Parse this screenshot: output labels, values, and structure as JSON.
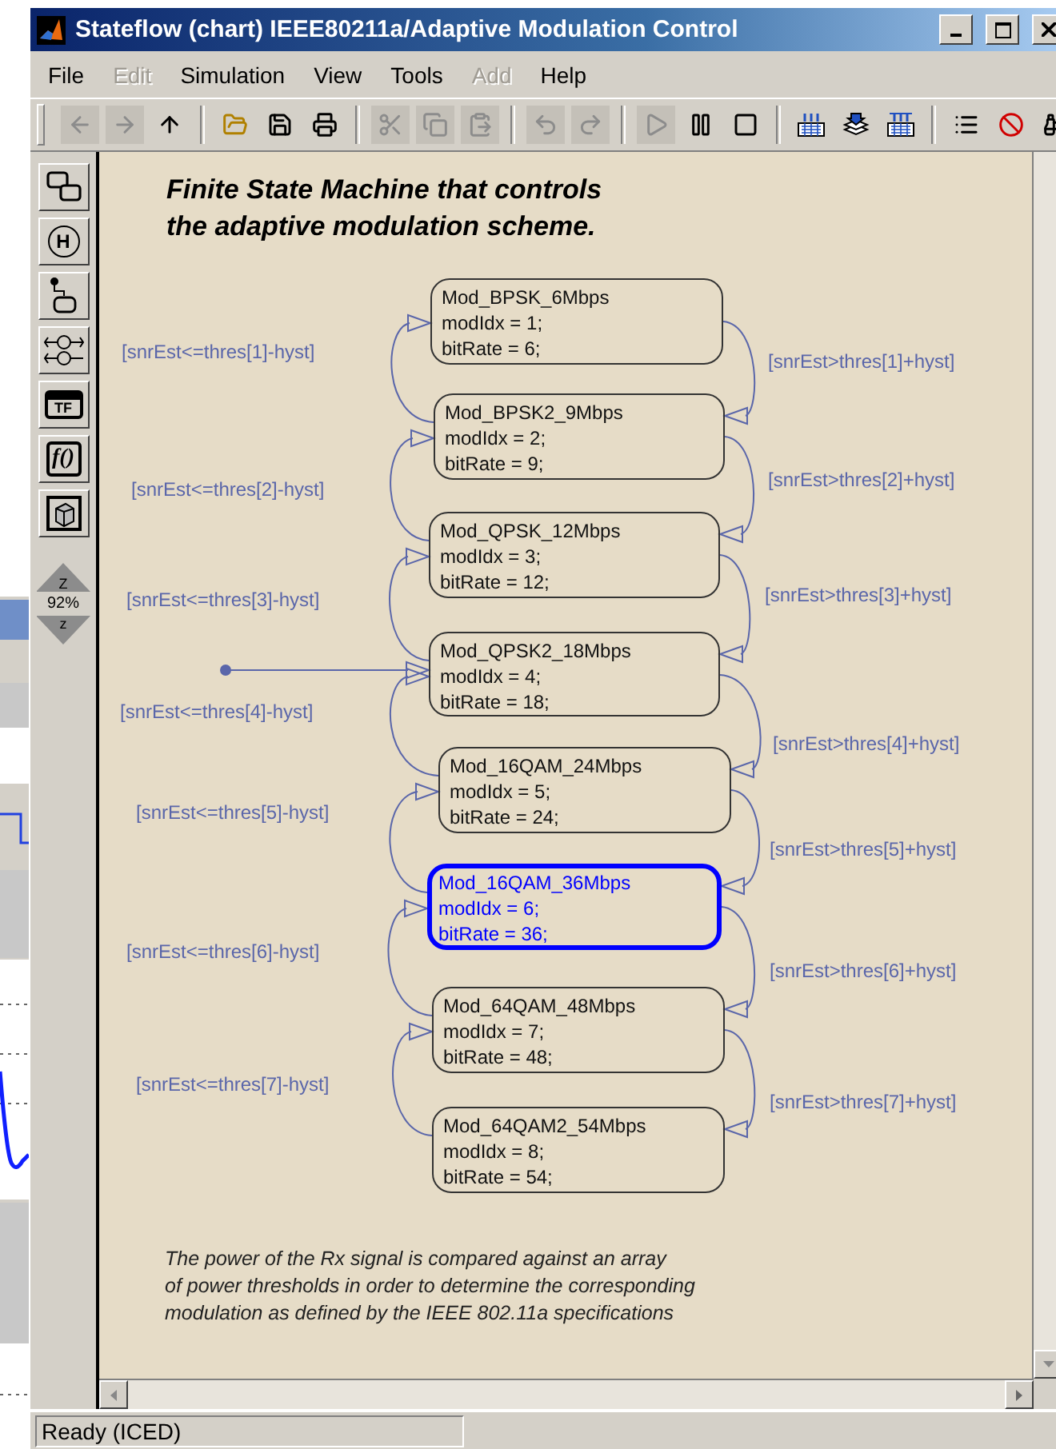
{
  "window": {
    "title": "Stateflow (chart) IEEE80211a/Adaptive Modulation Control"
  },
  "menu": [
    {
      "label": "File",
      "disabled": false
    },
    {
      "label": "Edit",
      "disabled": true
    },
    {
      "label": "Simulation",
      "disabled": false
    },
    {
      "label": "View",
      "disabled": false
    },
    {
      "label": "Tools",
      "disabled": false
    },
    {
      "label": "Add",
      "disabled": true
    },
    {
      "label": "Help",
      "disabled": false
    }
  ],
  "toolbar": [
    {
      "kind": "back",
      "disabled": true
    },
    {
      "kind": "forward",
      "disabled": true
    },
    {
      "kind": "up",
      "disabled": false
    },
    {
      "kind": "separator"
    },
    {
      "kind": "open",
      "disabled": false
    },
    {
      "kind": "save",
      "disabled": false
    },
    {
      "kind": "print",
      "disabled": false
    },
    {
      "kind": "separator"
    },
    {
      "kind": "cut",
      "disabled": true
    },
    {
      "kind": "copy",
      "disabled": true
    },
    {
      "kind": "paste",
      "disabled": true
    },
    {
      "kind": "separator"
    },
    {
      "kind": "undo",
      "disabled": true
    },
    {
      "kind": "redo",
      "disabled": true
    },
    {
      "kind": "separator"
    },
    {
      "kind": "start",
      "disabled": true
    },
    {
      "kind": "pause",
      "disabled": false
    },
    {
      "kind": "stop",
      "disabled": false
    },
    {
      "kind": "separator"
    },
    {
      "kind": "build",
      "disabled": false
    },
    {
      "kind": "update",
      "disabled": false
    },
    {
      "kind": "build_all",
      "disabled": false
    },
    {
      "kind": "separator"
    },
    {
      "kind": "explorer",
      "disabled": false
    },
    {
      "kind": "debugger",
      "disabled": false
    },
    {
      "kind": "find",
      "disabled": false
    }
  ],
  "palette": [
    {
      "kind": "state"
    },
    {
      "kind": "history",
      "label": "H"
    },
    {
      "kind": "default_transition"
    },
    {
      "kind": "junction"
    },
    {
      "kind": "truth_table",
      "label": "TF"
    },
    {
      "kind": "function",
      "label": "f()"
    },
    {
      "kind": "box"
    }
  ],
  "zoom": {
    "in_label": "Z",
    "percent": "92%",
    "out_label": "z"
  },
  "chart": {
    "title": [
      "Finite State Machine that controls",
      "the adaptive modulation scheme."
    ],
    "states": [
      {
        "name": "Mod_BPSK_6Mbps",
        "actions": [
          "modIdx = 1;",
          "bitRate = 6;"
        ],
        "active": false
      },
      {
        "name": "Mod_BPSK2_9Mbps",
        "actions": [
          "modIdx = 2;",
          "bitRate = 9;"
        ],
        "active": false
      },
      {
        "name": "Mod_QPSK_12Mbps",
        "actions": [
          "modIdx = 3;",
          "bitRate = 12;"
        ],
        "active": false
      },
      {
        "name": "Mod_QPSK2_18Mbps",
        "actions": [
          "modIdx = 4;",
          "bitRate = 18;"
        ],
        "active": false
      },
      {
        "name": "Mod_16QAM_24Mbps",
        "actions": [
          "modIdx = 5;",
          "bitRate = 24;"
        ],
        "active": false
      },
      {
        "name": "Mod_16QAM_36Mbps",
        "actions": [
          "modIdx = 6;",
          "bitRate = 36;"
        ],
        "active": true
      },
      {
        "name": "Mod_64QAM_48Mbps",
        "actions": [
          "modIdx = 7;",
          "bitRate = 48;"
        ],
        "active": false
      },
      {
        "name": "Mod_64QAM2_54Mbps",
        "actions": [
          "modIdx = 8;",
          "bitRate = 54;"
        ],
        "active": false
      }
    ],
    "left_transitions": [
      "[snrEst<=thres[1]-hyst]",
      "[snrEst<=thres[2]-hyst]",
      "[snrEst<=thres[3]-hyst]",
      "[snrEst<=thres[4]-hyst]",
      "[snrEst<=thres[5]-hyst]",
      "[snrEst<=thres[6]-hyst]",
      "[snrEst<=thres[7]-hyst]"
    ],
    "right_transitions": [
      "[snrEst>thres[1]+hyst]",
      "[snrEst>thres[2]+hyst]",
      "[snrEst>thres[3]+hyst]",
      "[snrEst>thres[4]+hyst]",
      "[snrEst>thres[5]+hyst]",
      "[snrEst>thres[6]+hyst]",
      "[snrEst>thres[7]+hyst]"
    ],
    "note": [
      "The power of the Rx signal is compared against an array",
      "of power thresholds in order to determine the corresponding",
      "modulation as defined by the IEEE 802.11a specifications"
    ]
  },
  "status_bar": "Ready (ICED)"
}
